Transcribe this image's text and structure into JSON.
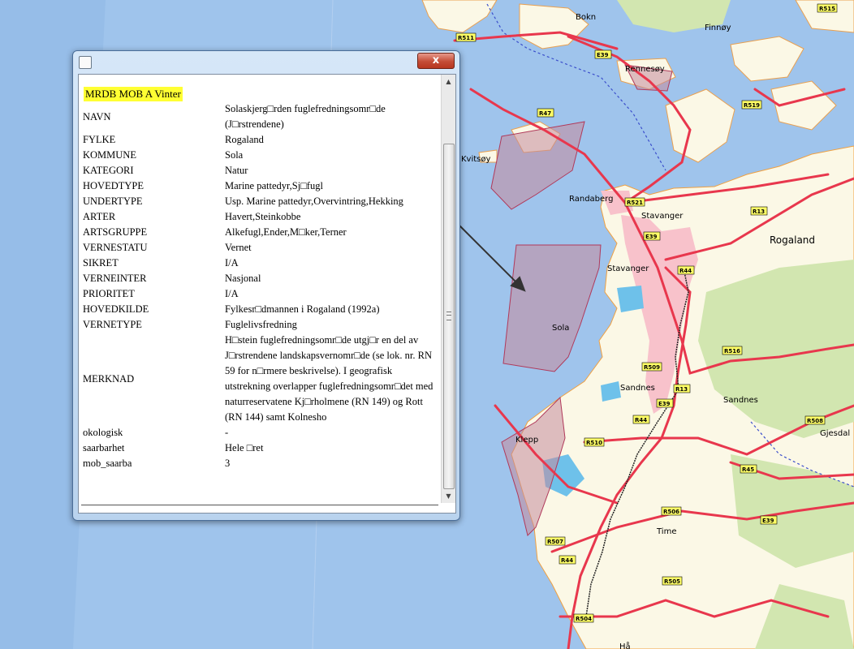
{
  "map": {
    "places": [
      "Bokn",
      "Finnøy",
      "Rennesøy",
      "Kvitsøy",
      "Randaberg",
      "Stavanger",
      "Stavanger",
      "Rogaland",
      "Sola",
      "Sandnes",
      "Sandnes",
      "Gjesdal",
      "Klepp",
      "Time",
      "Hå"
    ],
    "roads": [
      "R511",
      "E39",
      "R515",
      "R519",
      "R47",
      "R521",
      "R13",
      "E39",
      "R44",
      "R516",
      "R509",
      "R13",
      "E39",
      "R44",
      "R510",
      "R508",
      "R45",
      "R506",
      "E39",
      "R507",
      "R44",
      "R505",
      "R504"
    ],
    "colors": {
      "sea": "#9fc4ec",
      "land": "#fbf8e6",
      "green": "#d2e6b0",
      "urban": "#f8c2cb",
      "road": "#e8374d",
      "protected": "#b0395a",
      "water": "#6ec1ea",
      "county_border": "#3b4ecb"
    }
  },
  "window": {
    "close_label": "x",
    "title_badge": "MRDB MOB A Vinter",
    "rows": [
      {
        "key": "NAVN",
        "value": "Solaskjerg□rden fuglefredningsomr□de (J□rstrendene)"
      },
      {
        "key": "FYLKE",
        "value": "Rogaland"
      },
      {
        "key": "KOMMUNE",
        "value": "Sola"
      },
      {
        "key": "KATEGORI",
        "value": "Natur"
      },
      {
        "key": "HOVEDTYPE",
        "value": "Marine pattedyr,Sj□fugl"
      },
      {
        "key": "UNDERTYPE",
        "value": "Usp. Marine pattedyr,Overvintring,Hekking"
      },
      {
        "key": "ARTER",
        "value": "Havert,Steinkobbe"
      },
      {
        "key": "ARTSGRUPPE",
        "value": "Alkefugl,Ender,M□ker,Terner"
      },
      {
        "key": "VERNESTATU",
        "value": "Vernet"
      },
      {
        "key": "SIKRET",
        "value": "I/A"
      },
      {
        "key": "VERNEINTER",
        "value": "Nasjonal"
      },
      {
        "key": "PRIORITET",
        "value": "I/A"
      },
      {
        "key": "HOVEDKILDE",
        "value": "Fylkesr□dmannen i Rogaland (1992a)"
      },
      {
        "key": "VERNETYPE",
        "value": "Fuglelivsfredning"
      },
      {
        "key": "MERKNAD",
        "value": "H□stein fuglefredningsomr□de utgj□r en del av J□rstrendene landskapsvernomr□de (se lok. nr. RN 59 for n□rmere beskrivelse). I geografisk utstrekning overlapper fuglefredningsomr□det med naturreservatene Kj□rholmene (RN 149) og Rott (RN 144) samt Kolnesho"
      },
      {
        "key": "okologisk",
        "value": "-"
      },
      {
        "key": "saarbarhet",
        "value": "Hele □ret"
      },
      {
        "key": "mob_saarba",
        "value": "3"
      }
    ]
  }
}
